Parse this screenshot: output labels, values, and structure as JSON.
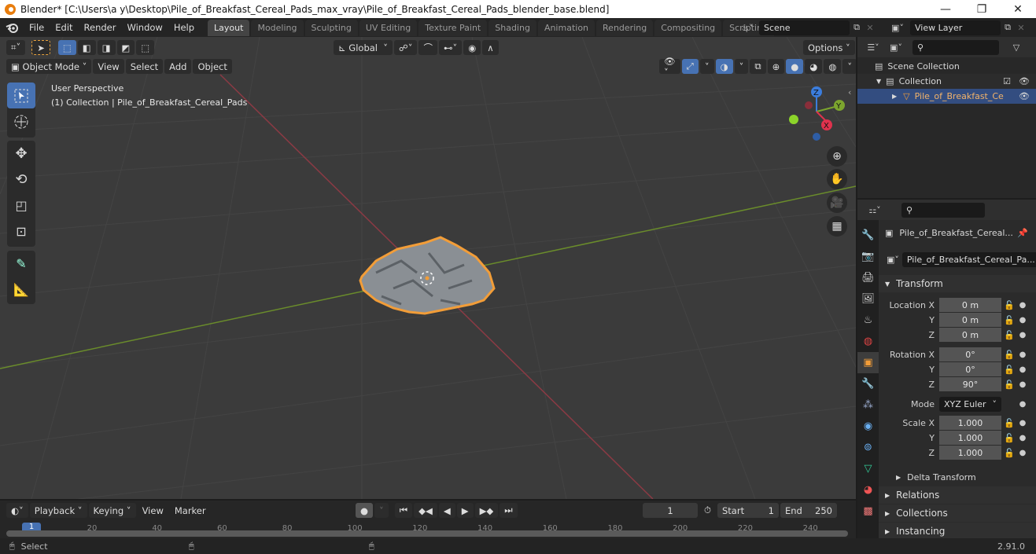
{
  "titlebar": {
    "title": "Blender* [C:\\Users\\a y\\Desktop\\Pile_of_Breakfast_Cereal_Pads_max_vray\\Pile_of_Breakfast_Cereal_Pads_blender_base.blend]",
    "minimize": "—",
    "restore": "❐",
    "close": "✕"
  },
  "menubar": {
    "items": [
      "File",
      "Edit",
      "Render",
      "Window",
      "Help"
    ]
  },
  "workspaces": {
    "tabs": [
      "Layout",
      "Modeling",
      "Sculpting",
      "UV Editing",
      "Texture Paint",
      "Shading",
      "Animation",
      "Rendering",
      "Compositing",
      "Scripting"
    ],
    "active": "Layout",
    "add": "+"
  },
  "scene": {
    "name": "Scene"
  },
  "view_layer": {
    "name": "View Layer"
  },
  "viewport": {
    "mode": "Object Mode",
    "menus": [
      "View",
      "Select",
      "Add",
      "Object"
    ],
    "transform_orientation": "Global",
    "options_label": "Options",
    "perspective_label": "User Perspective",
    "object_label": "(1) Collection | Pile_of_Breakfast_Cereal_Pads",
    "gizmo_axes": {
      "x": "X",
      "y": "Y",
      "z": "Z"
    },
    "colors": {
      "x_axis": "#8b3a44",
      "y_axis": "#6a8c2b",
      "selection": "#f29d38",
      "active_tool": "#4772b3"
    }
  },
  "outliner": {
    "search_placeholder": "",
    "items": [
      {
        "label": "Scene Collection",
        "level": 0
      },
      {
        "label": "Collection",
        "level": 1
      },
      {
        "label": "Pile_of_Breakfast_Ce",
        "level": 2,
        "selected": true
      }
    ]
  },
  "properties": {
    "search_placeholder": "",
    "object_name": "Pile_of_Breakfast_Cereal...",
    "data_name": "Pile_of_Breakfast_Cereal_Pa...",
    "transform_header": "Transform",
    "location_label": "Location X",
    "rotation_label": "Rotation X",
    "scale_label": "Scale X",
    "y_label": "Y",
    "z_label": "Z",
    "location": {
      "x": "0 m",
      "y": "0 m",
      "z": "0 m"
    },
    "rotation": {
      "x": "0°",
      "y": "0°",
      "z": "90°"
    },
    "mode_label": "Mode",
    "rotation_mode": "XYZ Euler",
    "scale": {
      "x": "1.000",
      "y": "1.000",
      "z": "1.000"
    },
    "subsections": [
      "Delta Transform"
    ],
    "sections": [
      "Relations",
      "Collections",
      "Instancing"
    ]
  },
  "timeline": {
    "menus": [
      "Playback",
      "Keying",
      "View",
      "Marker"
    ],
    "current_frame": "1",
    "start_label": "Start",
    "start": "1",
    "end_label": "End",
    "end": "250",
    "ruler": [
      "20",
      "40",
      "60",
      "80",
      "100",
      "120",
      "140",
      "160",
      "180",
      "200",
      "220",
      "240"
    ],
    "current_marker": "1"
  },
  "statusbar": {
    "select_label": "Select",
    "version": "2.91.0"
  }
}
